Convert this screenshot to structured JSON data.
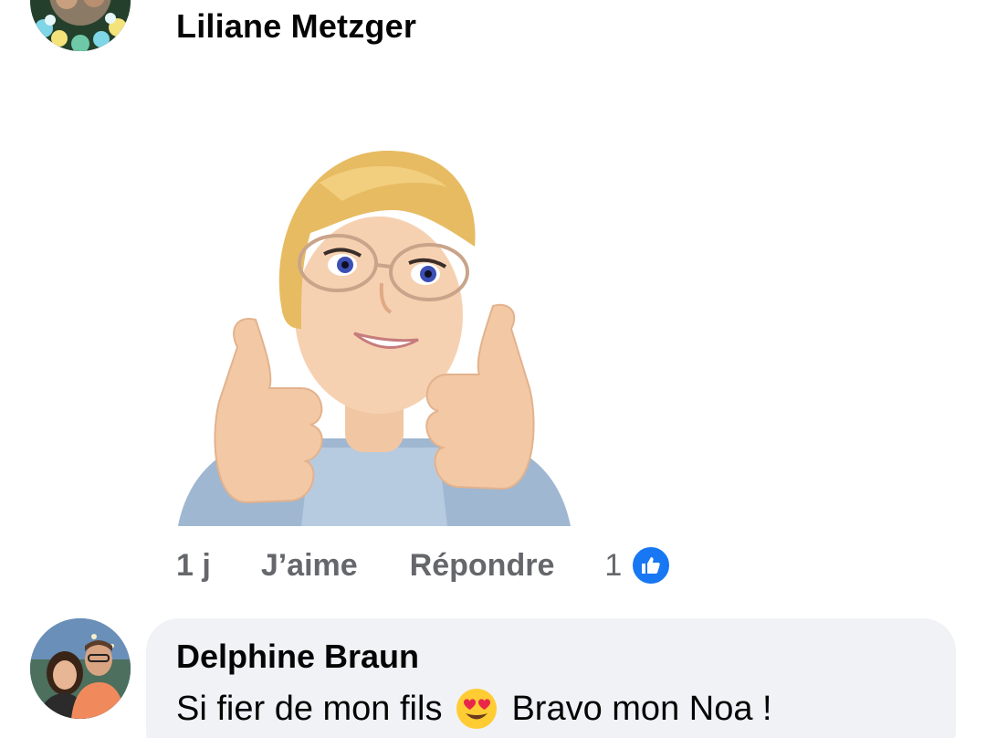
{
  "comments": [
    {
      "author": "Liliane Metzger",
      "avatar_icon": "profile-photo-flowers",
      "attachment": "avatar-sticker-thumbs-up",
      "actions": {
        "time": "1 j",
        "like_label": "J’aime",
        "reply_label": "Répondre",
        "reaction_count": "1",
        "reaction_icon": "like-thumbs-up-icon"
      }
    },
    {
      "author": "Delphine Braun",
      "avatar_icon": "profile-photo-couple",
      "text_before_emoji": "Si fier de mon fils",
      "emoji": "heart-eyes-emoji",
      "text_after_emoji": "Bravo mon Noa !"
    }
  ],
  "colors": {
    "secondary_text": "#65676b",
    "like_blue": "#1877f2",
    "bubble_bg": "#f0f2f5"
  }
}
